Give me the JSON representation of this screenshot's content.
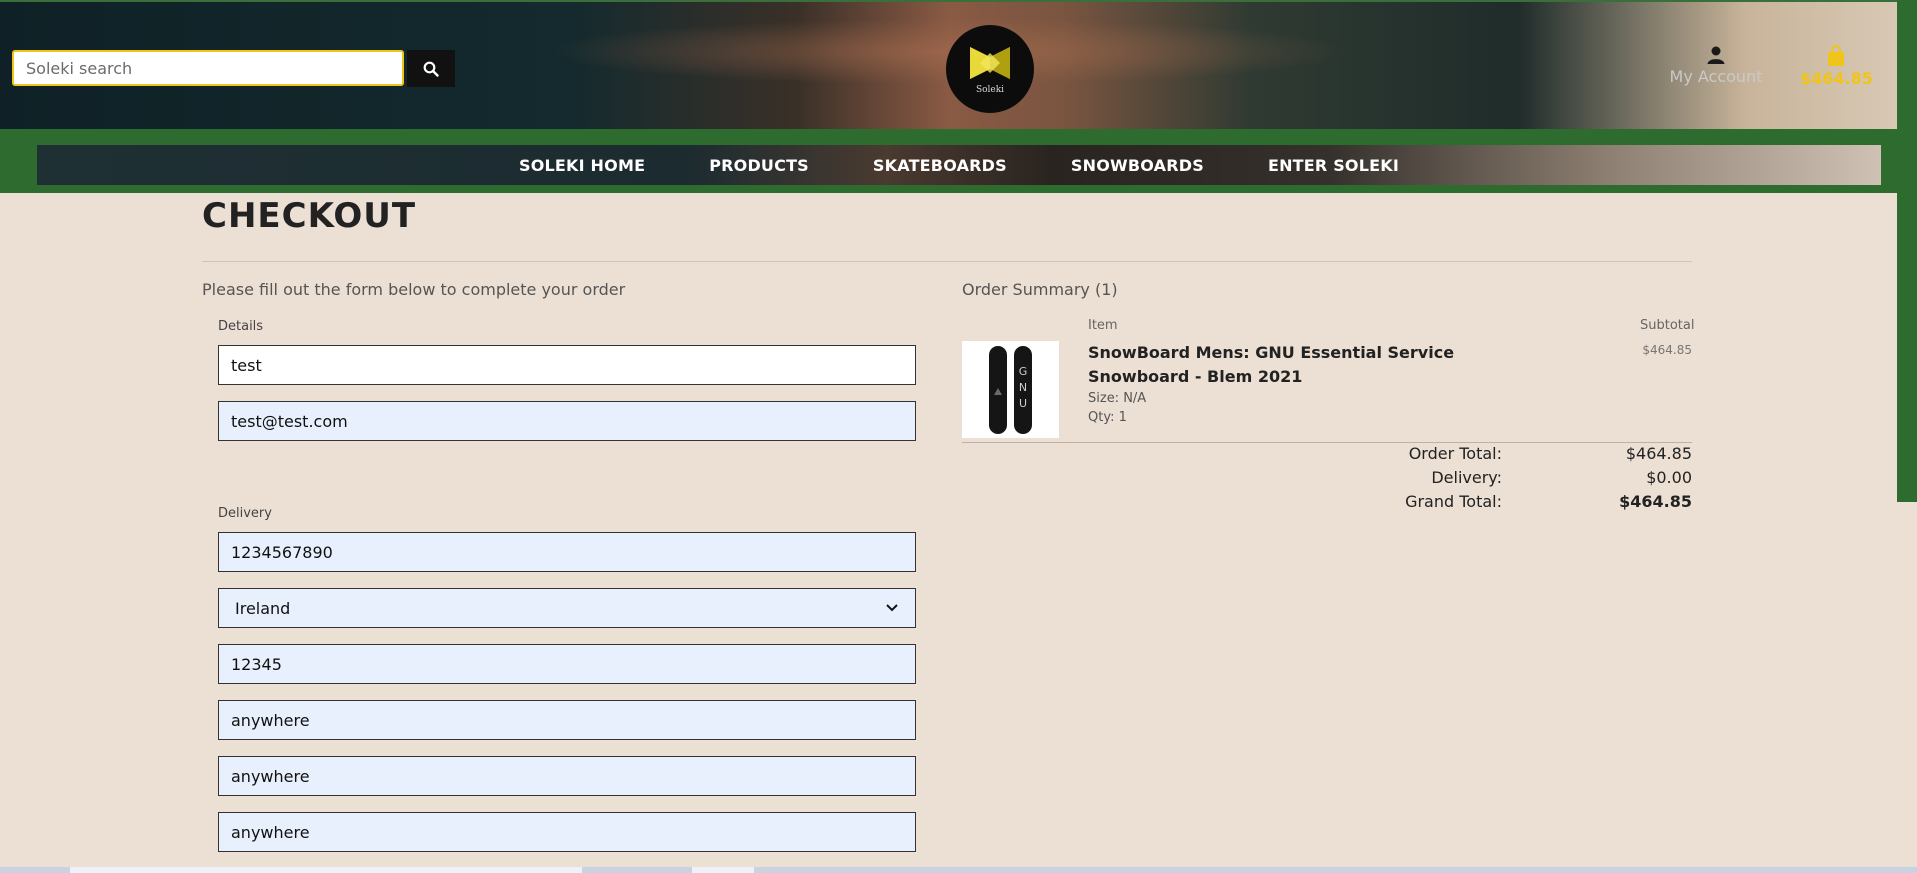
{
  "header": {
    "search": {
      "placeholder": "Soleki search",
      "value": ""
    },
    "logo_text": "Soleki",
    "account_label": "My Account",
    "cart_total": "$464.85"
  },
  "nav": {
    "items": [
      {
        "label": "SOLEKI HOME"
      },
      {
        "label": "PRODUCTS"
      },
      {
        "label": "SKATEBOARDS"
      },
      {
        "label": "SNOWBOARDS"
      },
      {
        "label": "ENTER SOLEKI"
      }
    ]
  },
  "checkout": {
    "title": "CHECKOUT",
    "intro": "Please fill out the form below to complete your order",
    "details_label": "Details",
    "details": {
      "name": "test",
      "email": "test@test.com"
    },
    "delivery_label": "Delivery",
    "delivery": {
      "phone": "1234567890",
      "country": "Ireland",
      "postcode": "12345",
      "town": "anywhere",
      "street1": "anywhere",
      "street2": "anywhere"
    }
  },
  "order_summary": {
    "title": "Order Summary (1)",
    "item_header": "Item",
    "subtotal_header": "Subtotal",
    "items": [
      {
        "name": "SnowBoard Mens: GNU Essential Service Snowboard - Blem 2021",
        "size": "Size: N/A",
        "qty": "Qty: 1",
        "subtotal": "$464.85"
      }
    ],
    "order_total_label": "Order Total:",
    "order_total": "$464.85",
    "delivery_label": "Delivery:",
    "delivery": "$0.00",
    "grand_total_label": "Grand Total:",
    "grand_total": "$464.85"
  },
  "colors": {
    "accent_yellow": "#f0c419",
    "nav_green": "#2e6b2e",
    "page_bg": "#ece0d4",
    "autofill_bg": "#e8f0fe"
  },
  "icons": [
    "search-icon",
    "user-icon",
    "shopping-bag-icon",
    "chevron-down-icon"
  ]
}
